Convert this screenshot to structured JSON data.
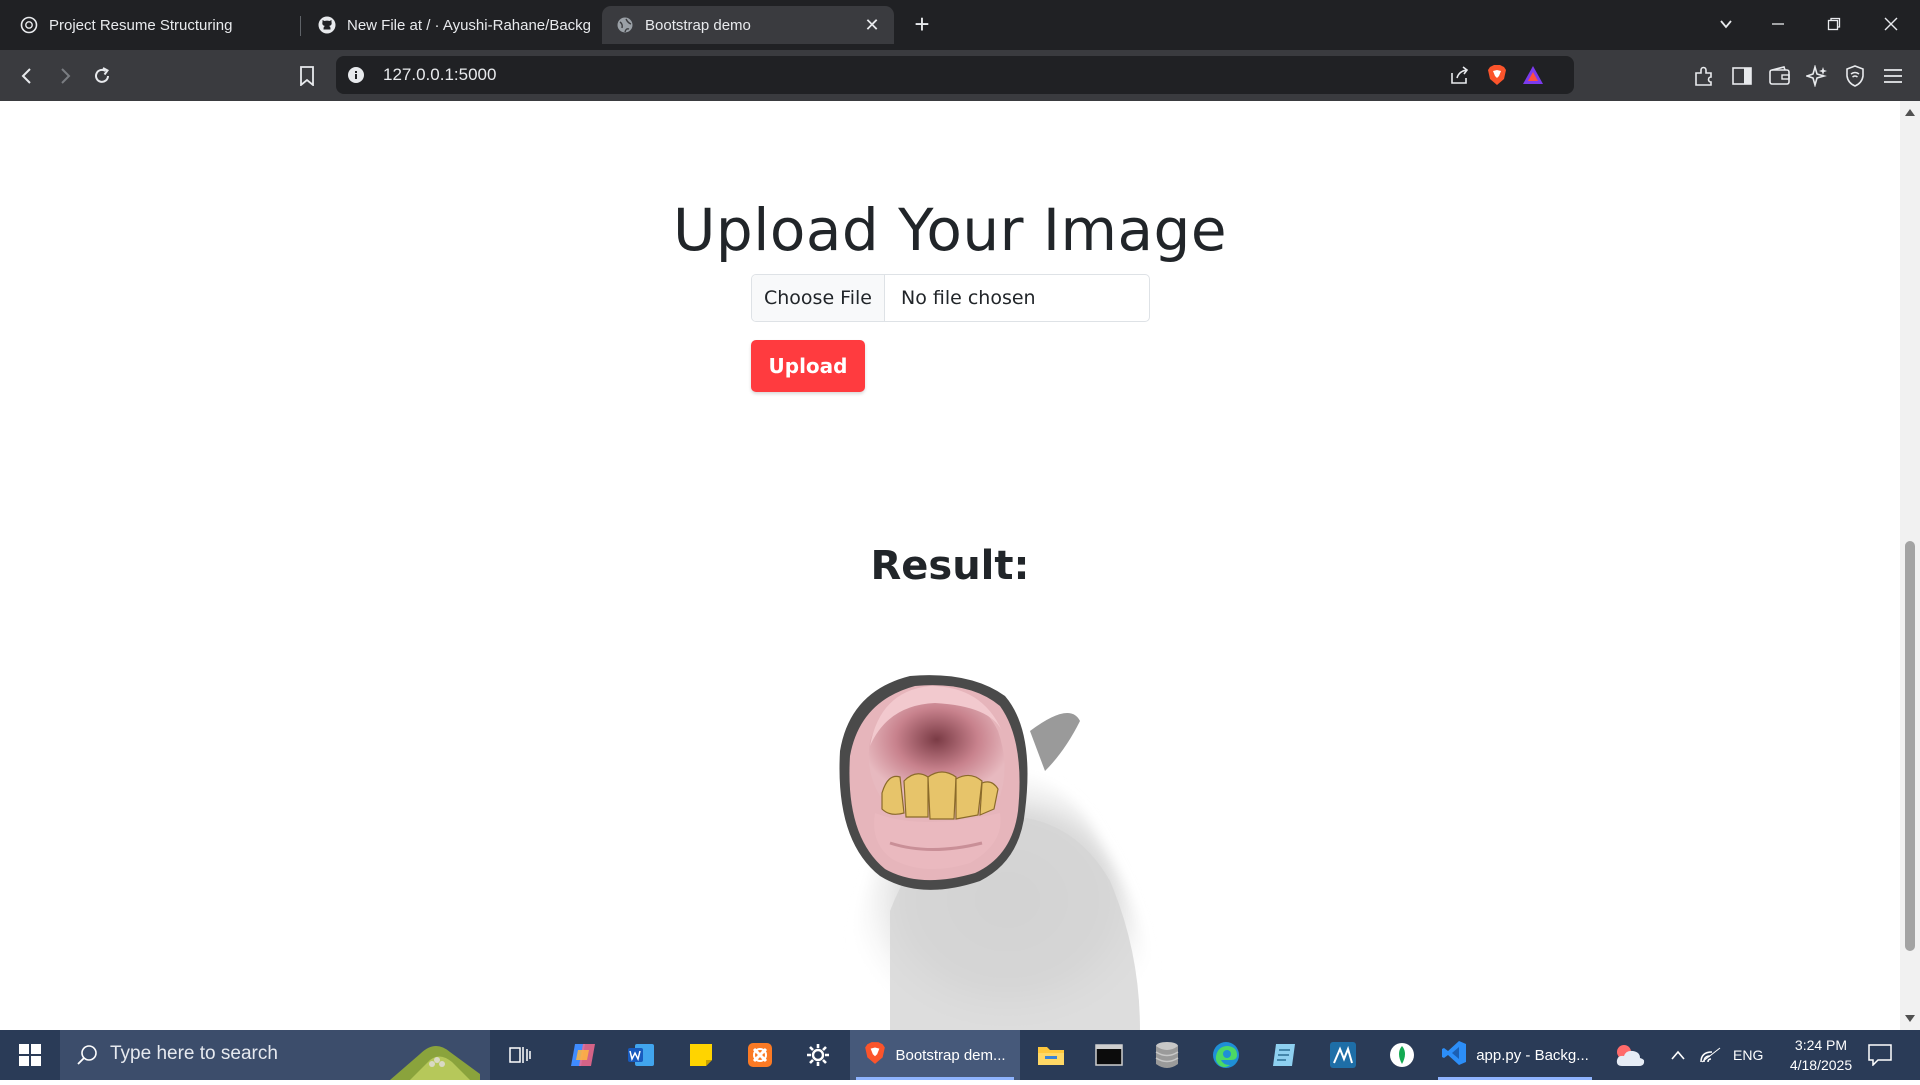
{
  "browser": {
    "tabs": [
      {
        "title": "Project Resume Structuring",
        "icon": "openai-icon",
        "active": false
      },
      {
        "title": "New File at / · Ayushi-Rahane/Backg",
        "icon": "github-icon",
        "active": false
      },
      {
        "title": "Bootstrap demo",
        "icon": "globe-icon",
        "active": true
      }
    ],
    "url": "127.0.0.1:5000"
  },
  "page": {
    "heading": "Upload Your Image",
    "file_input": {
      "button_label": "Choose File",
      "status": "No file chosen"
    },
    "upload_button": "Upload",
    "result_heading": "Result:",
    "result_image": "horse-teeth-image"
  },
  "taskbar": {
    "search_placeholder": "Type here to search",
    "apps": [
      {
        "name": "Bootstrap dem...",
        "icon": "brave-icon"
      },
      {
        "name": "app.py - Backg...",
        "icon": "vscode-icon"
      }
    ],
    "tray": {
      "language": "ENG",
      "time": "3:24 PM",
      "date": "4/18/2025"
    }
  },
  "colors": {
    "upload_button": "#ff3b3f",
    "tabbar": "#202124",
    "toolbar": "#3a3b3f",
    "taskbar": "#2a3b57"
  }
}
